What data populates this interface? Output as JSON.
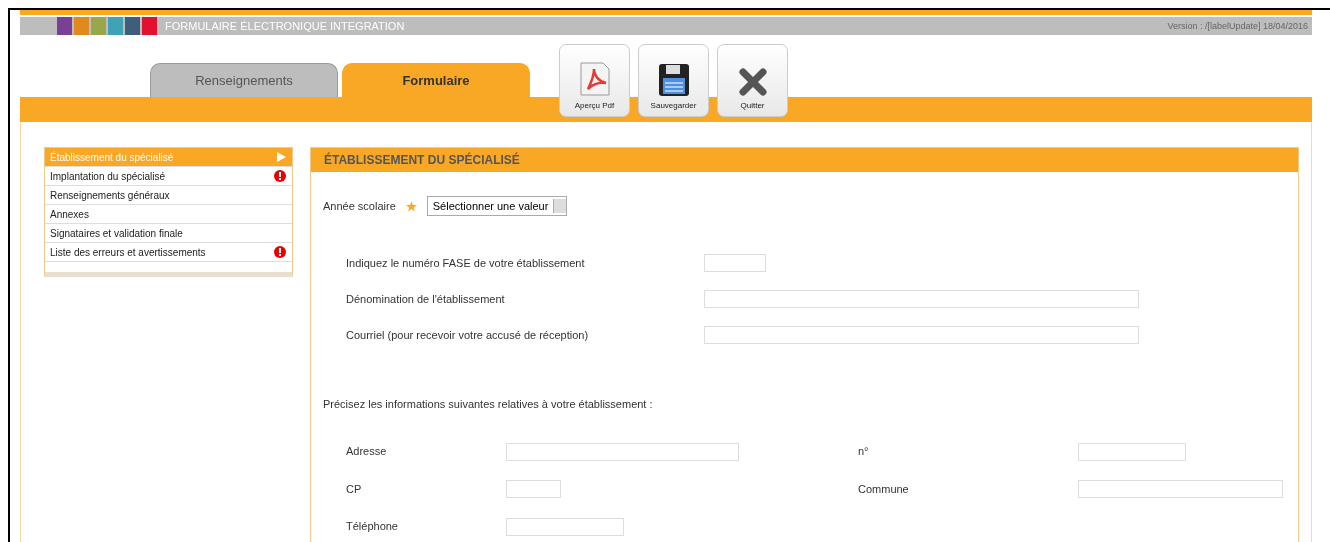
{
  "header": {
    "title": "FORMULAIRE ÉLECTRONIQUE INTEGRATION",
    "version": "Version : /[labelUpdate] 18/04/2016"
  },
  "tabs": [
    {
      "label": "Renseignements",
      "selected": false
    },
    {
      "label": "Formulaire",
      "selected": true
    }
  ],
  "toolbar": [
    {
      "kind": "pdf",
      "label": "Aperçu Pdf"
    },
    {
      "kind": "save",
      "label": "Sauvegarder"
    },
    {
      "kind": "quit",
      "label": "Quitter"
    }
  ],
  "sidebar": {
    "items": [
      {
        "label": "Établissement du spécialisé",
        "selected": true,
        "error": false
      },
      {
        "label": "Implantation du spécialisé",
        "selected": false,
        "error": true
      },
      {
        "label": "Renseignements généraux",
        "selected": false,
        "error": false
      },
      {
        "label": "Annexes",
        "selected": false,
        "error": false
      },
      {
        "label": "Signataires et validation finale",
        "selected": false,
        "error": false
      },
      {
        "label": "Liste des erreurs et avertissements",
        "selected": false,
        "error": true
      }
    ]
  },
  "section": {
    "title": "ÉTABLISSEMENT DU SPÉCIALISÉ",
    "school_year": {
      "label": "Année scolaire",
      "required": true,
      "value": "Sélectionner une valeur"
    },
    "fields": [
      {
        "label": "Indiquez le numéro FASE de votre établissement"
      },
      {
        "label": "Dénomination de l'établissement"
      },
      {
        "label": "Courriel (pour recevoir votre accusé de réception)"
      }
    ],
    "info_text": "Précisez les informations suivantes relatives à votre établissement :",
    "address_fields": [
      {
        "label": "Adresse"
      },
      {
        "label": "n°"
      },
      {
        "label": "CP"
      },
      {
        "label": "Commune"
      },
      {
        "label": "Téléphone"
      }
    ]
  }
}
